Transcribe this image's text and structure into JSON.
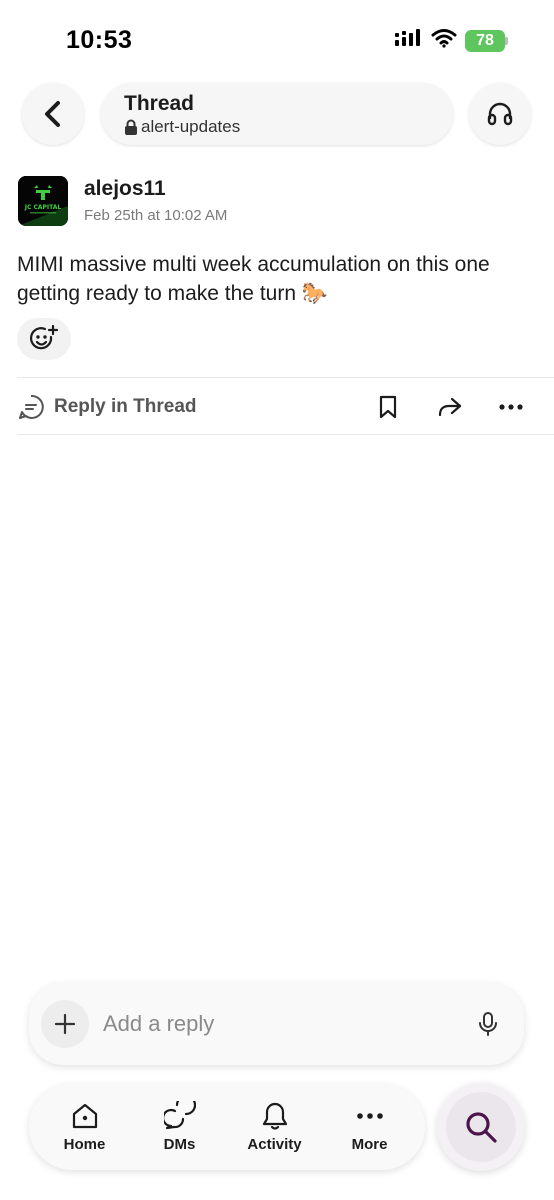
{
  "status_bar": {
    "time": "10:53",
    "battery": "78"
  },
  "header": {
    "title": "Thread",
    "channel": "alert-updates"
  },
  "message": {
    "author": "alejos11",
    "timestamp": "Feb 25th at 10:02 AM",
    "text": "MIMI massive multi week accumulation on this one getting ready to make the turn 🐎",
    "avatar_text": "JC CAPITAL"
  },
  "actions": {
    "reply_in_thread": "Reply in Thread"
  },
  "composer": {
    "placeholder": "Add a reply"
  },
  "tabs": [
    {
      "label": "Home",
      "icon": "home-icon"
    },
    {
      "label": "DMs",
      "icon": "dms-icon"
    },
    {
      "label": "Activity",
      "icon": "bell-icon"
    },
    {
      "label": "More",
      "icon": "more-icon"
    }
  ],
  "colors": {
    "accent": "#4a154b",
    "battery": "#5fc65f",
    "avatar_green": "#3ecf3e"
  }
}
